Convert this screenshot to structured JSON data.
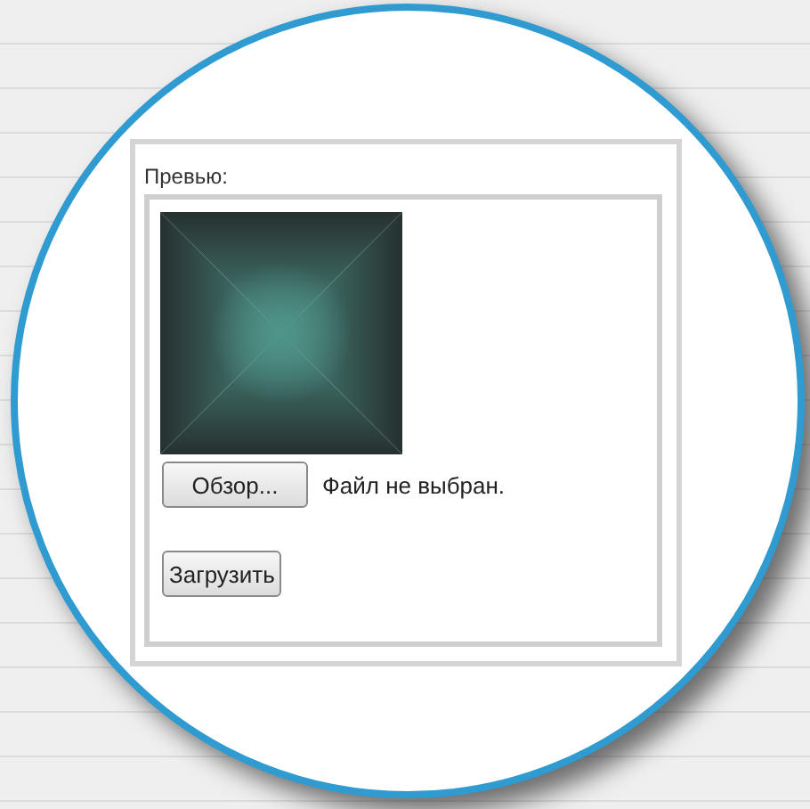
{
  "panel": {
    "label": "Превью:",
    "browse_button": "Обзор...",
    "file_status": "Файл не выбран.",
    "upload_button": "Загрузить"
  }
}
